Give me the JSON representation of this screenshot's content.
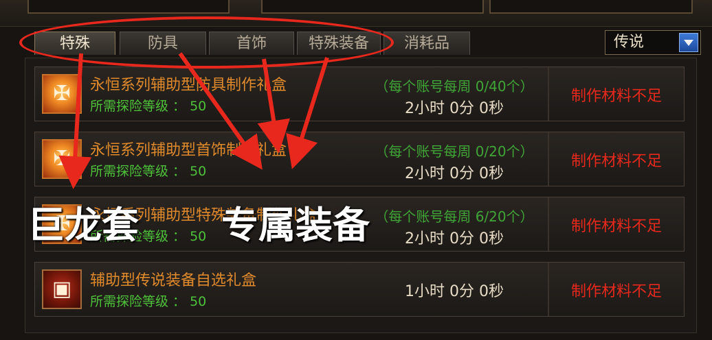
{
  "tabs": [
    {
      "label": "特殊",
      "active": true
    },
    {
      "label": "防具",
      "active": false
    },
    {
      "label": "首饰",
      "active": false
    },
    {
      "label": "特殊装备",
      "active": false
    },
    {
      "label": "消耗品",
      "active": false
    }
  ],
  "filter": {
    "selected": "传说"
  },
  "items": [
    {
      "name": "永恒系列辅助型防具制作礼盒",
      "level_label": "所需探险等级 ： 50",
      "limit": "（每个账号每周 0/40个）",
      "time": "2小时 0分 0秒",
      "status": "制作材料不足"
    },
    {
      "name": "永恒系列辅助型首饰制作礼盒",
      "level_label": "所需探险等级 ： 50",
      "limit": "（每个账号每周 0/20个）",
      "time": "2小时 0分 0秒",
      "status": "制作材料不足"
    },
    {
      "name": "永恒系列辅助型特殊装备制作礼盒",
      "level_label": "所需探险等级 ： 50",
      "limit": "（每个账号每周 6/20个）",
      "time": "2小时 0分 0秒",
      "status": "制作材料不足"
    },
    {
      "name": "辅助型传说装备自选礼盒",
      "level_label": "所需探险等级 ： 50",
      "limit": "",
      "time": "1小时 0分 0秒",
      "status": "制作材料不足"
    }
  ],
  "annotations": {
    "label_left": "巨龙套",
    "label_right": "专属装备",
    "color": "#e8271d"
  },
  "colors": {
    "item_name": "#e08a2c",
    "level": "#4ec23a",
    "limit": "#3fa637",
    "status": "#e8281c"
  },
  "icons": {
    "box": "gift-box-icon",
    "chest": "chest-icon",
    "dropdown": "chevron-down-icon"
  }
}
